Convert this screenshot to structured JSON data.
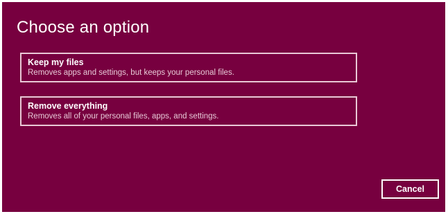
{
  "dialog": {
    "title": "Choose an option",
    "background_color": "#77003f",
    "options": [
      {
        "title": "Keep my files",
        "description": "Removes apps and settings, but keeps your personal files."
      },
      {
        "title": "Remove everything",
        "description": "Removes all of your personal files, apps, and settings."
      }
    ],
    "cancel_label": "Cancel"
  }
}
